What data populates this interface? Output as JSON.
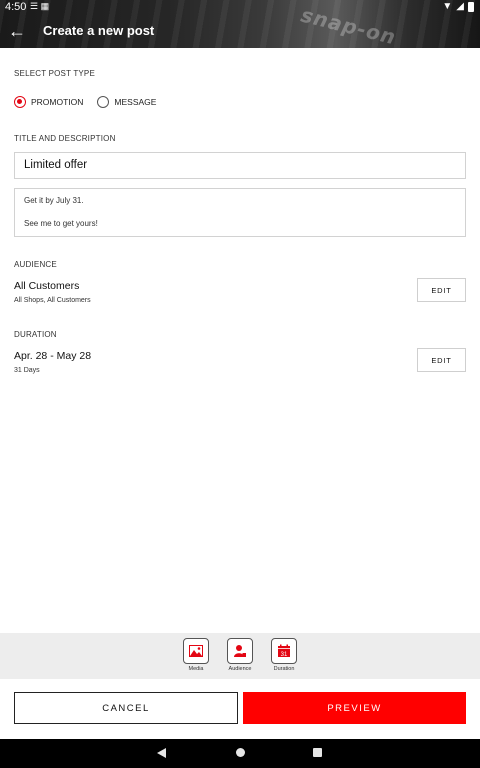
{
  "status_bar": {
    "time": "4:50"
  },
  "header": {
    "title": "Create a new post",
    "watermark": "snap-on"
  },
  "post_type": {
    "section_label": "SELECT POST TYPE",
    "options": [
      {
        "label": "PROMOTION",
        "selected": true
      },
      {
        "label": "MESSAGE",
        "selected": false
      }
    ],
    "accent_color": "#e30613"
  },
  "title_description": {
    "section_label": "TITLE AND DESCRIPTION",
    "title_value": "Limited offer",
    "description_lines": [
      "Get it by July 31.",
      "See me to get yours!"
    ]
  },
  "audience": {
    "section_label": "AUDIENCE",
    "value": "All Customers",
    "detail": "All Shops, All Customers",
    "edit_label": "EDIT"
  },
  "duration": {
    "section_label": "DURATION",
    "value": "Apr. 28 - May 28",
    "detail": "31 Days",
    "edit_label": "EDIT"
  },
  "toolbar": {
    "items": [
      {
        "label": "Media",
        "icon": "image-icon"
      },
      {
        "label": "Audience",
        "icon": "person-icon"
      },
      {
        "label": "Duration",
        "icon": "calendar-icon",
        "calendar_day": "31"
      }
    ]
  },
  "actions": {
    "cancel_label": "CANCEL",
    "preview_label": "PREVIEW",
    "preview_color": "#ff0000"
  }
}
